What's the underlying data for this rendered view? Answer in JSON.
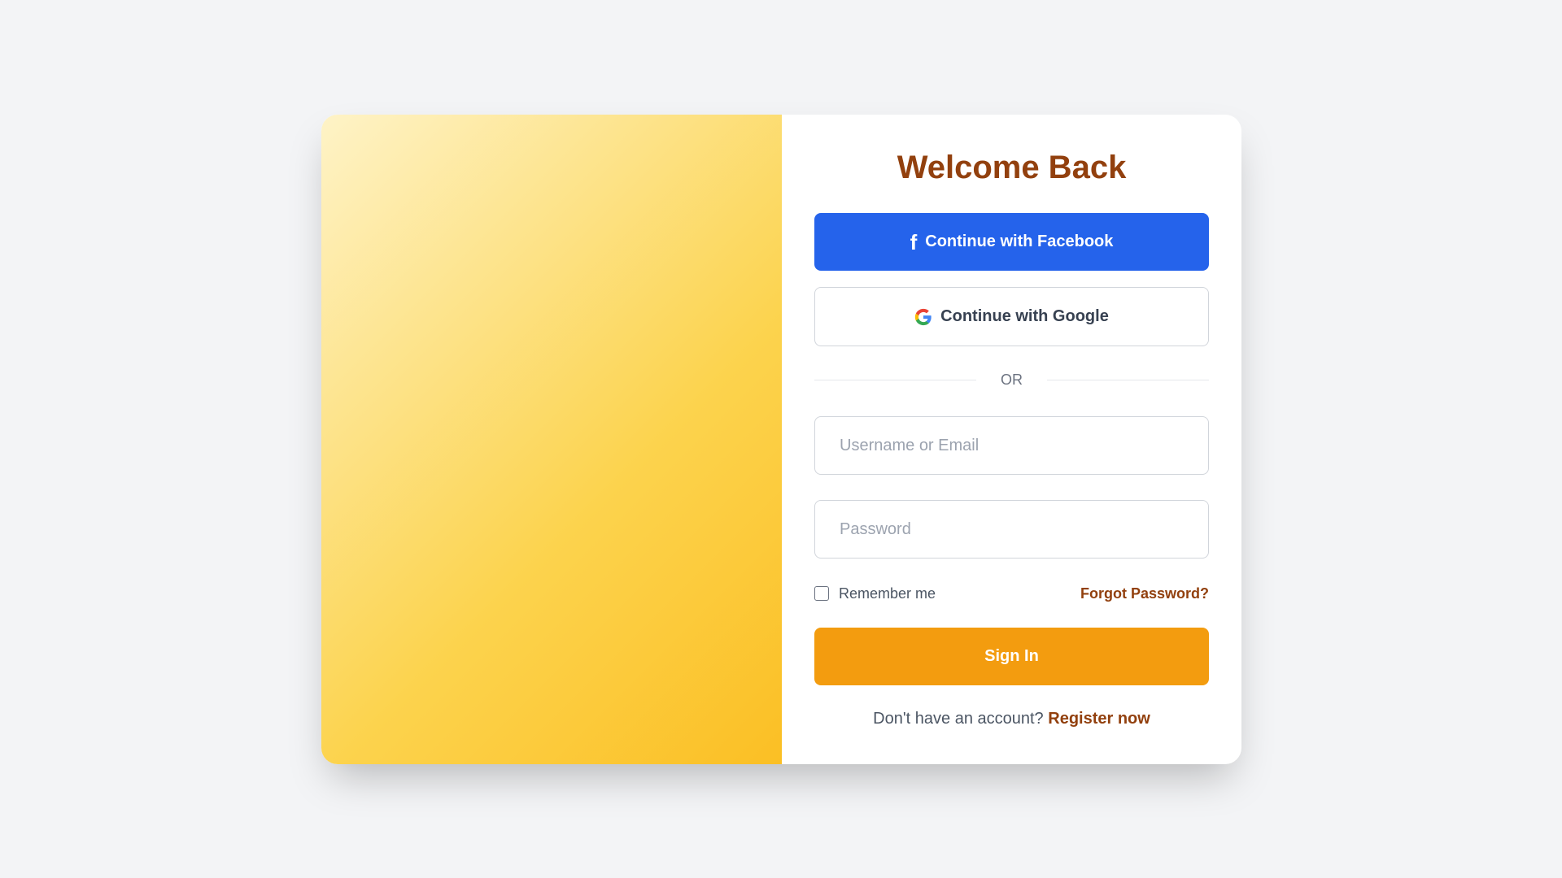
{
  "form": {
    "title": "Welcome Back",
    "facebook_label": "Continue with Facebook",
    "google_label": "Continue with Google",
    "divider_text": "OR",
    "username_placeholder": "Username or Email",
    "username_value": "",
    "password_placeholder": "Password",
    "password_value": "",
    "remember_label": "Remember me",
    "remember_checked": false,
    "forgot_label": "Forgot Password?",
    "signin_label": "Sign In",
    "register_prompt": "Don't have an account?",
    "register_link": "Register now"
  },
  "icons": {
    "facebook": "facebook-icon",
    "google": "google-icon"
  },
  "colors": {
    "page_bg": "#f3f4f6",
    "title": "#92400e",
    "facebook": "#2563eb",
    "signin": "#f39c0f",
    "link": "#92400e",
    "hero_start": "#fef3c7",
    "hero_end": "#fbbf24"
  }
}
